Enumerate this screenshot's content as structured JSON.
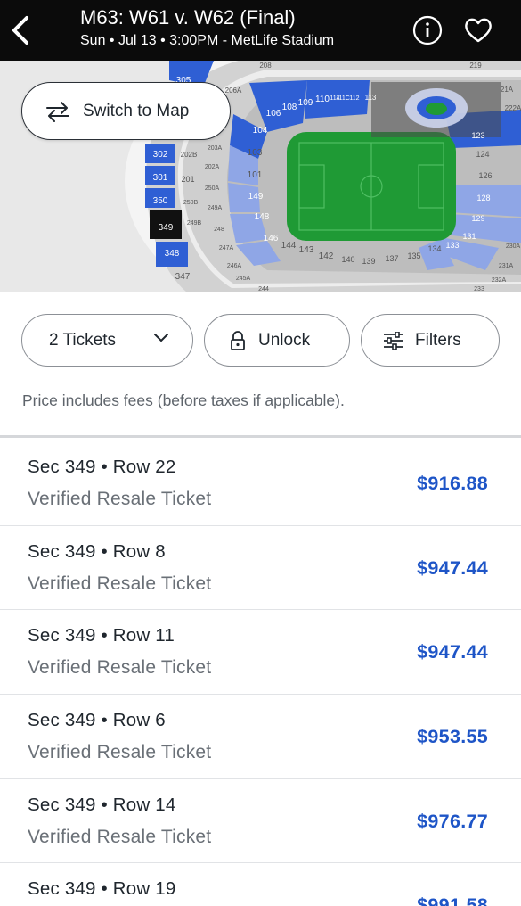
{
  "header": {
    "title": "M63: W61 v. W62 (Final)",
    "subtitle": "Sun • Jul 13 • 3:00PM - MetLife Stadium",
    "back_icon": "chevron-left-icon",
    "info_icon": "info-icon",
    "favorite_icon": "heart-icon"
  },
  "map": {
    "switch_label": "Switch to Map",
    "switch_icon": "swap-arrows-icon",
    "highlighted_section": "349",
    "colors": {
      "highlight": "#2f5fd4",
      "light_blue": "#8fa6e6",
      "grey": "#c9c9c9",
      "field": "#1f9a35",
      "selected": "#111111"
    },
    "sections": {
      "s305": "305",
      "s206A": "206A",
      "s208": "208",
      "s219": "219",
      "s21A": "21A",
      "s222A": "222A",
      "s110": "110",
      "s109": "109",
      "s108": "108",
      "s106": "106",
      "s104": "104",
      "s111C": "111C",
      "s112": "112",
      "s113": "113",
      "s114": "114",
      "s103": "103",
      "s101": "101",
      "s149": "149",
      "s148": "148",
      "s146": "146",
      "s144": "144",
      "s143": "143",
      "s142": "142",
      "s140": "140",
      "s139": "139",
      "s137": "137",
      "s135": "135",
      "s134": "134",
      "s133": "133",
      "s131": "131",
      "s129": "129",
      "s128": "128",
      "s126": "126",
      "s124": "124",
      "s123": "123",
      "s302": "302",
      "s301": "301",
      "s350": "350",
      "s349": "349",
      "s348": "348",
      "s347": "347",
      "s202B": "202B",
      "s202A": "202A",
      "s203A": "203A",
      "s201": "201",
      "s250A": "250A",
      "s250B": "250B",
      "s249A": "249A",
      "s249B": "249B",
      "s248": "248",
      "s247A": "247A",
      "s246A": "246A",
      "s245A": "245A",
      "s244": "244",
      "s230A": "230A",
      "s231A": "231A",
      "s232A": "232A",
      "s233": "233"
    }
  },
  "filters": {
    "tickets_label": "2 Tickets",
    "tickets_icon": "chevron-down-icon",
    "unlock_label": "Unlock",
    "unlock_icon": "lock-icon",
    "filters_label": "Filters",
    "filters_icon": "sliders-icon",
    "price_note": "Price includes fees (before taxes if applicable)."
  },
  "listings": [
    {
      "section_row": "Sec 349 • Row 22",
      "type": "Verified Resale Ticket",
      "price": "$916.88"
    },
    {
      "section_row": "Sec 349 • Row 8",
      "type": "Verified Resale Ticket",
      "price": "$947.44"
    },
    {
      "section_row": "Sec 349 • Row 11",
      "type": "Verified Resale Ticket",
      "price": "$947.44"
    },
    {
      "section_row": "Sec 349 • Row 6",
      "type": "Verified Resale Ticket",
      "price": "$953.55"
    },
    {
      "section_row": "Sec 349 • Row 14",
      "type": "Verified Resale Ticket",
      "price": "$976.77"
    },
    {
      "section_row": "Sec 349 • Row 19",
      "type": "Verified Resale Ticket",
      "price": "$991.58"
    }
  ]
}
